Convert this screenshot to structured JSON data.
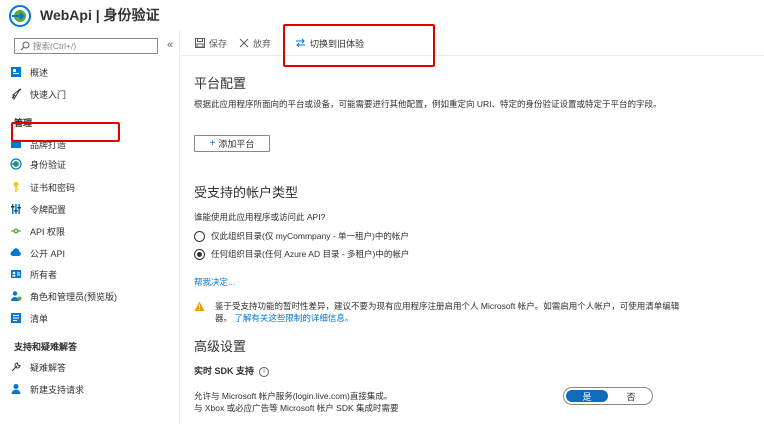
{
  "header": {
    "title": "WebApi | 身份验证"
  },
  "sidebar": {
    "search_placeholder": "搜索(Ctrl+/)",
    "collapse_label": "«",
    "items_top": [
      {
        "label": "概述",
        "icon": "overview-icon"
      },
      {
        "label": "快速入门",
        "icon": "rocket-icon"
      }
    ],
    "section_manage": "管理",
    "items_manage": [
      {
        "label": "品牌打造",
        "icon": "branding-icon"
      },
      {
        "label": "身份验证",
        "icon": "authentication-icon"
      },
      {
        "label": "证书和密码",
        "icon": "key-icon"
      },
      {
        "label": "令牌配置",
        "icon": "token-config-icon"
      },
      {
        "label": "API 权限",
        "icon": "api-permissions-icon"
      },
      {
        "label": "公开 API",
        "icon": "cloud-icon"
      },
      {
        "label": "所有者",
        "icon": "owners-icon"
      },
      {
        "label": "角色和管理员(预览版)",
        "icon": "roles-icon"
      },
      {
        "label": "清单",
        "icon": "manifest-icon"
      }
    ],
    "section_support": "支持和疑难解答",
    "items_support": [
      {
        "label": "疑难解答",
        "icon": "wrench-icon"
      },
      {
        "label": "新建支持请求",
        "icon": "support-person-icon"
      }
    ]
  },
  "toolbar": {
    "save_label": "保存",
    "discard_label": "放弃",
    "switch_label": "切换到旧体验"
  },
  "main": {
    "platform_title": "平台配置",
    "platform_desc": "根据此应用程序所面向的平台或设备，可能需要进行其他配置，例如重定向 URI、特定的身份验证设置或特定于平台的字段。",
    "add_platform_label": "添加平台",
    "account_title": "受支持的帐户类型",
    "account_question": "谁能使用此应用程序或访问此 API?",
    "account_options": [
      {
        "label": "仅此组织目录(仅 myCommpany - 单一租户)中的帐户",
        "checked": false
      },
      {
        "label": "任何组织目录(任何 Azure AD 目录 - 多租户)中的帐户",
        "checked": true
      }
    ],
    "help_link": "帮我决定...",
    "warning_text": "鉴于受支持功能的暂时性差异，建议不要为现有应用程序注册启用个人 Microsoft 帐户。如需启用个人帐户，可使用清单编辑器。",
    "warning_link": "了解有关这些限制的详细信息。",
    "advanced_title": "高级设置",
    "sdk_label": "实时 SDK 支持",
    "sdk_desc_line1": "允许与 Microsoft 帐户服务(login.live.com)直接集成。",
    "sdk_desc_line2": "与 Xbox 或必应广告等 Microsoft 帐户 SDK 集成时需要",
    "toggle_yes": "是",
    "toggle_no": "否"
  }
}
